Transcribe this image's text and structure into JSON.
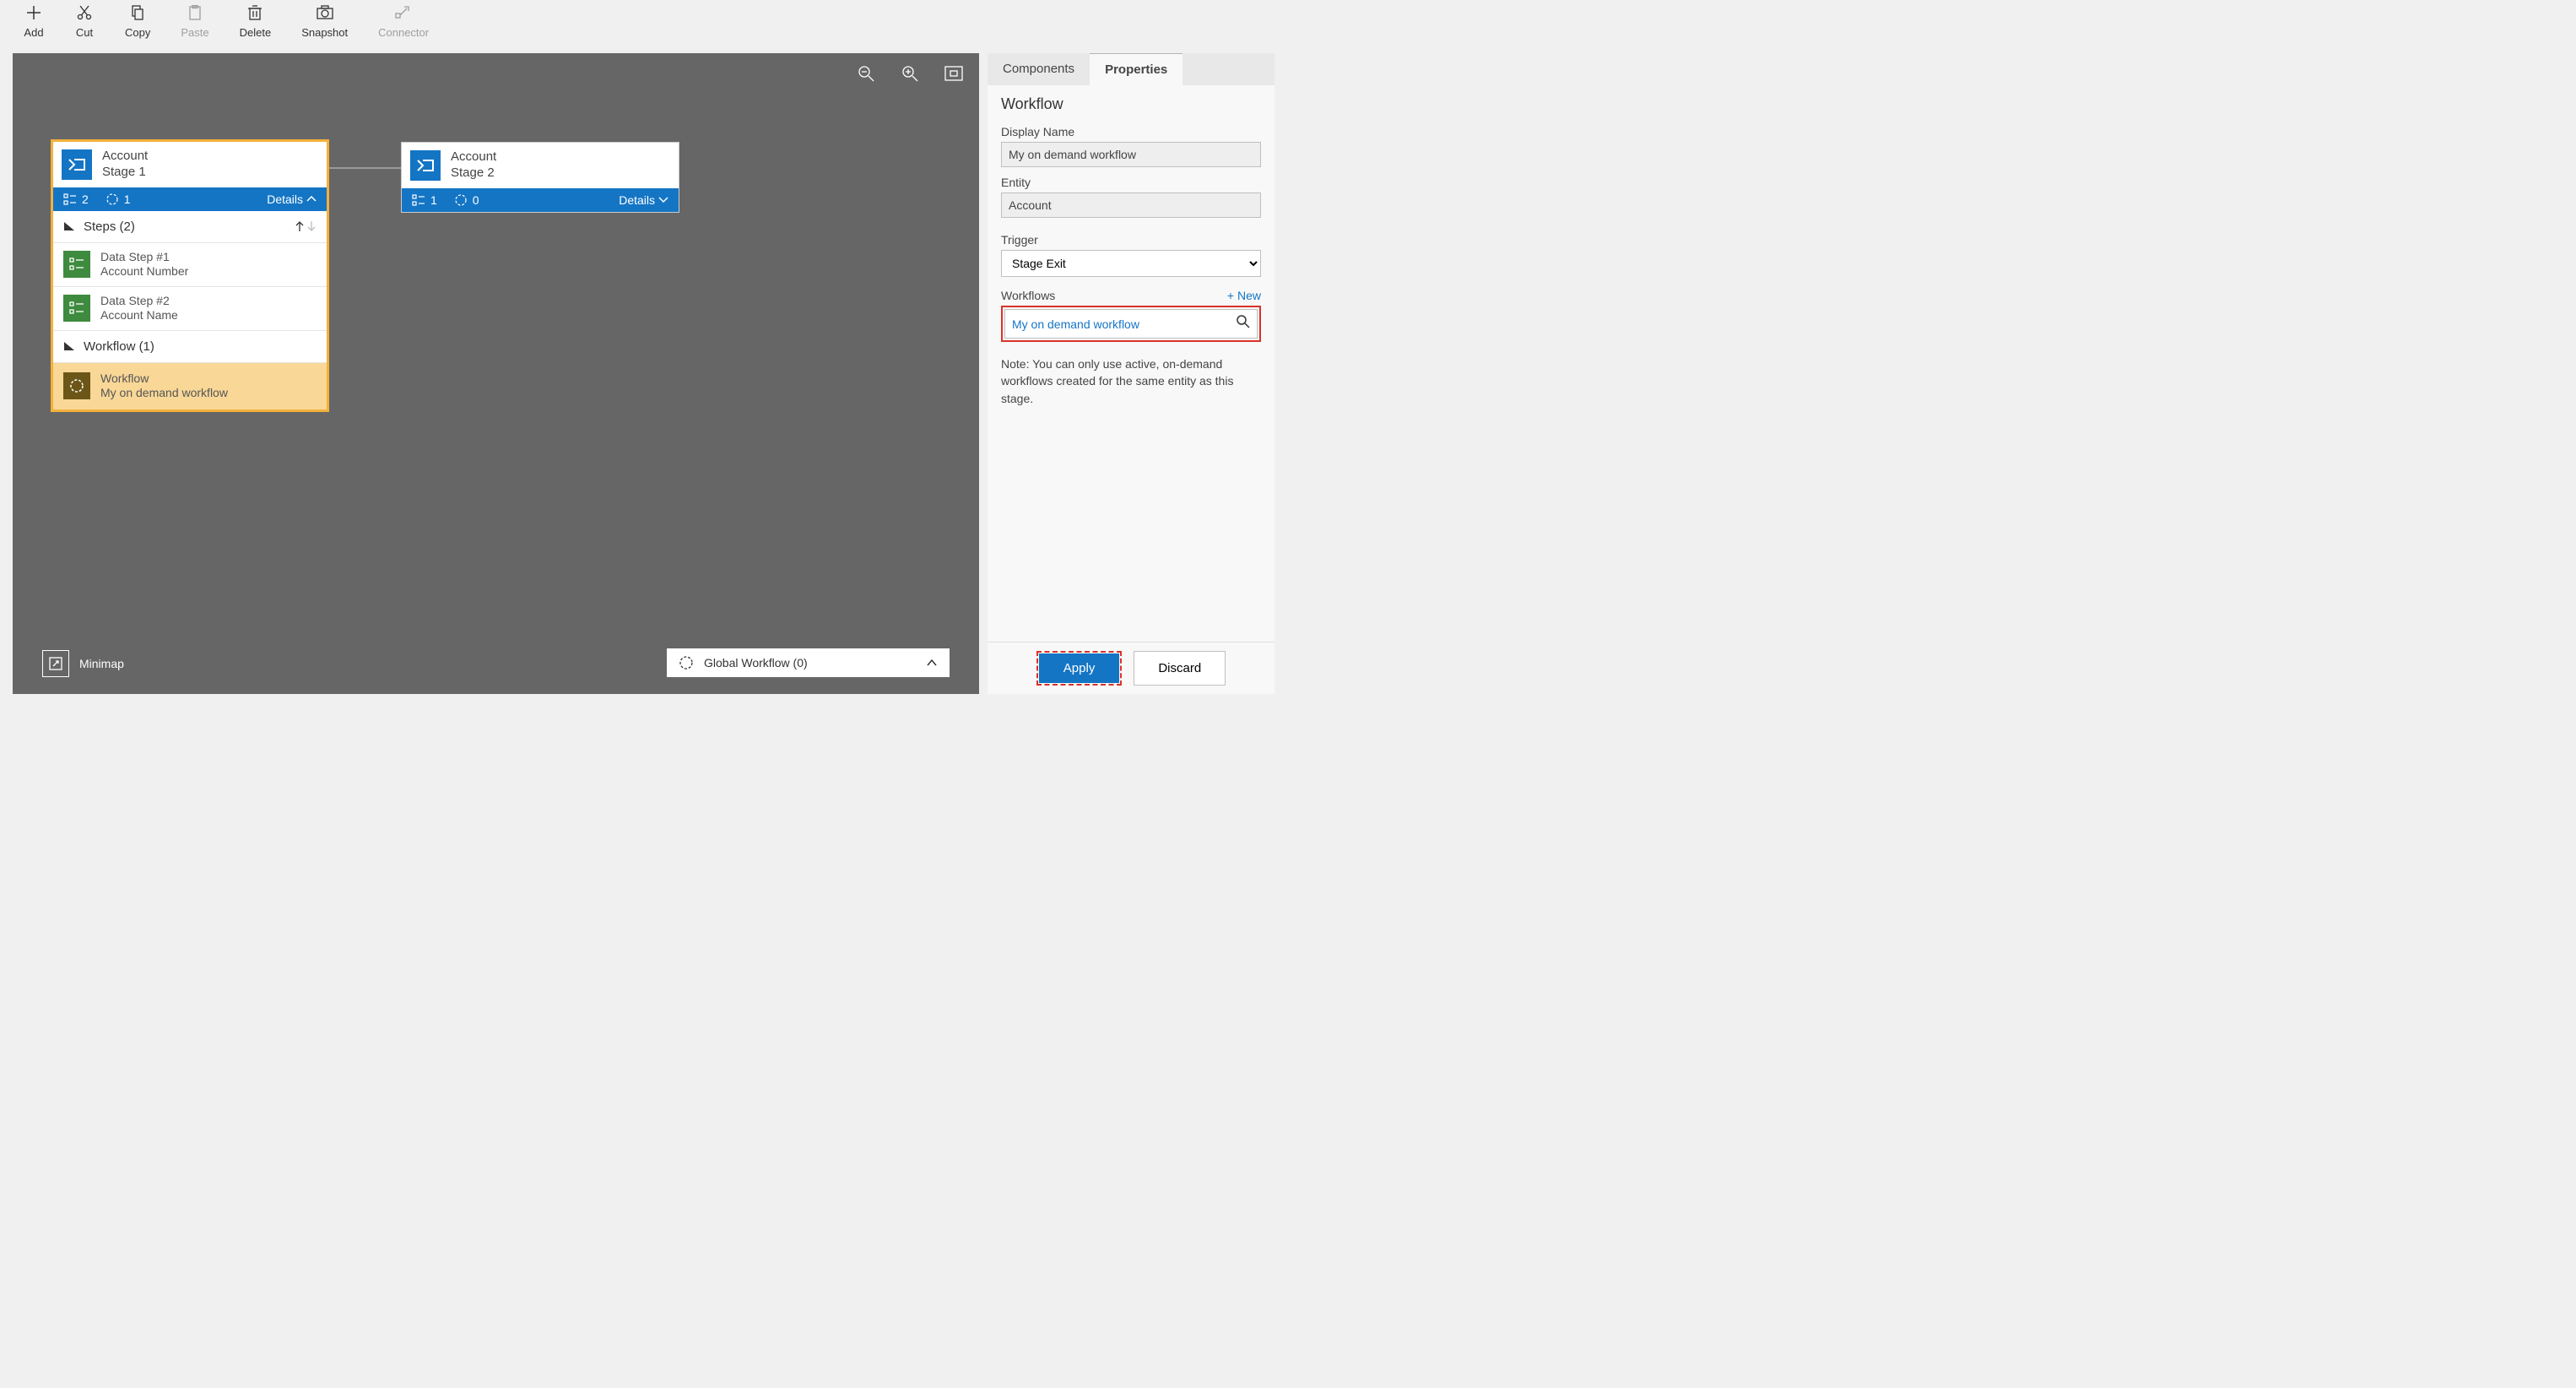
{
  "toolbar": {
    "add": "Add",
    "cut": "Cut",
    "copy": "Copy",
    "paste": "Paste",
    "delete": "Delete",
    "snapshot": "Snapshot",
    "connector": "Connector"
  },
  "canvas": {
    "stage1": {
      "entity": "Account",
      "name": "Stage 1",
      "step_count": "2",
      "wf_count": "1",
      "details": "Details",
      "steps_header": "Steps (2)",
      "step1_title": "Data Step #1",
      "step1_sub": "Account Number",
      "step2_title": "Data Step #2",
      "step2_sub": "Account Name",
      "wf_header": "Workflow (1)",
      "wf_item_title": "Workflow",
      "wf_item_sub": "My on demand workflow"
    },
    "stage2": {
      "entity": "Account",
      "name": "Stage 2",
      "step_count": "1",
      "wf_count": "0",
      "details": "Details"
    },
    "minimap": "Minimap",
    "global_wf": "Global Workflow (0)"
  },
  "sidebar": {
    "tab_components": "Components",
    "tab_properties": "Properties",
    "heading": "Workflow",
    "display_name_label": "Display Name",
    "display_name_value": "My on demand workflow",
    "entity_label": "Entity",
    "entity_value": "Account",
    "trigger_label": "Trigger",
    "trigger_value": "Stage Exit",
    "workflows_label": "Workflows",
    "new_link": "+ New",
    "search_value": "My on demand workflow",
    "note": "Note: You can only use active, on-demand workflows created for the same entity as this stage.",
    "apply": "Apply",
    "discard": "Discard"
  }
}
